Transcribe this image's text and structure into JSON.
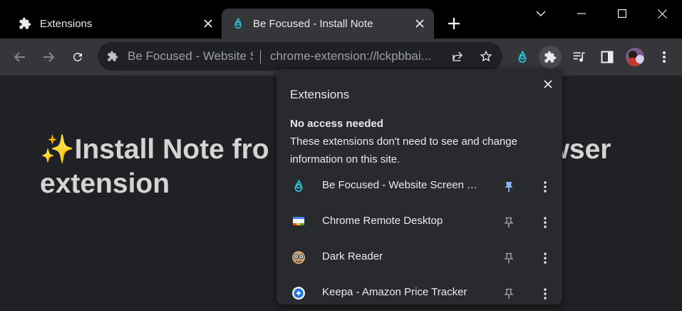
{
  "tabs": [
    {
      "title": "Extensions",
      "icon": "puzzle-icon",
      "active": false
    },
    {
      "title": "Be Focused - Install Note",
      "icon": "flame-icon",
      "active": true
    }
  ],
  "window_controls": [
    "minimize",
    "maximize",
    "close"
  ],
  "toolbar": {
    "back": "arrow-left-icon",
    "forward": "arrow-right-icon",
    "reload": "reload-icon"
  },
  "omnibox": {
    "site_name": "Be Focused - Website S",
    "url": "chrome-extension://lckpbbai..."
  },
  "page": {
    "heading_emoji": "✨",
    "heading_text": "Install Note from ... browser extension",
    "heading_line1_left": "Install Note fro",
    "heading_line1_right": "wser",
    "heading_line2": "extension"
  },
  "extensions_popup": {
    "title": "Extensions",
    "section_title": "No access needed",
    "section_desc": "These extensions don't need to see and change information on this site.",
    "items": [
      {
        "name": "Be Focused - Website Screen Ti...",
        "pinned": true,
        "icon": "flame-icon"
      },
      {
        "name": "Chrome Remote Desktop",
        "pinned": false,
        "icon": "remote-desktop-icon"
      },
      {
        "name": "Dark Reader",
        "pinned": false,
        "icon": "dark-reader-icon"
      },
      {
        "name": "Keepa - Amazon Price Tracker",
        "pinned": false,
        "icon": "keepa-icon"
      }
    ]
  },
  "colors": {
    "tab_strip": "#000000",
    "toolbar": "#35363a",
    "page_bg": "#202124",
    "popup_bg": "#292a2d",
    "pin_active": "#8ab4f8",
    "flame_accent": "#2bc4d8"
  }
}
